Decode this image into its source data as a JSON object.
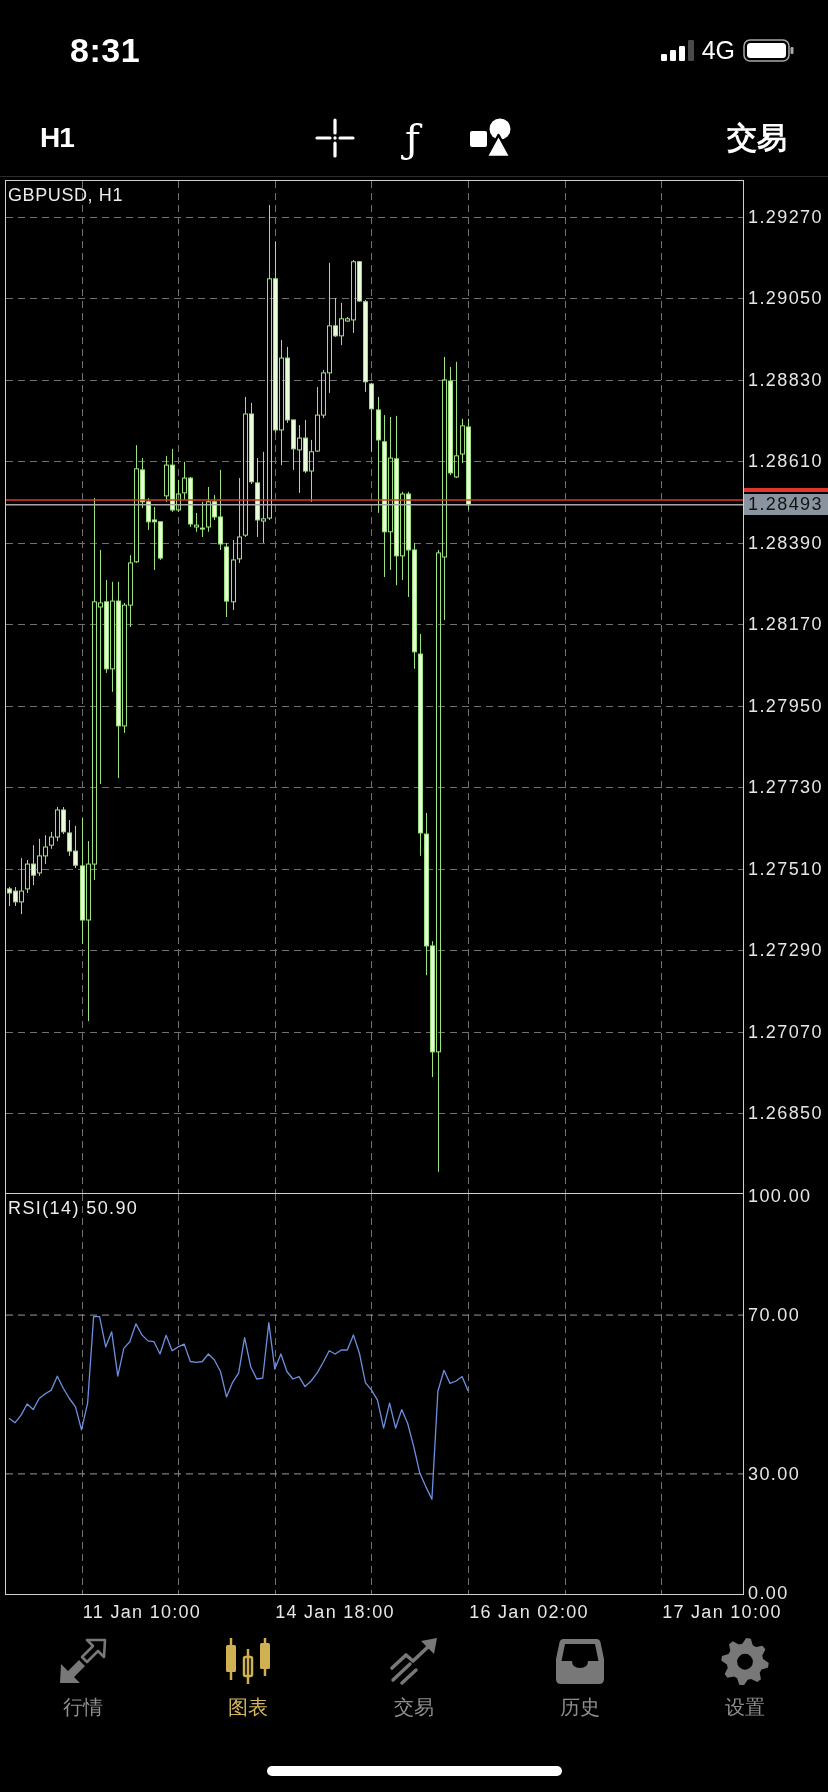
{
  "status_bar": {
    "time": "8:31",
    "network": "4G"
  },
  "toolbar": {
    "timeframe": "H1",
    "function_button": "ƒ",
    "trade_button": "交易"
  },
  "chart": {
    "current_price": "1.28493",
    "chart_data": {
      "type": "candlestick",
      "title": "GBPUSD, H1",
      "grid": true,
      "categories": [
        null,
        null,
        null,
        null,
        null,
        null,
        null,
        null,
        null,
        null,
        null,
        null,
        null,
        null,
        null,
        null,
        null,
        null,
        null,
        null,
        null,
        null,
        null,
        null,
        null,
        null,
        null,
        null,
        null,
        null,
        null,
        null,
        null,
        null,
        null,
        null,
        null,
        null,
        null,
        null,
        null,
        null,
        null,
        null,
        null,
        null,
        null,
        null,
        null,
        null,
        null,
        null,
        null,
        null,
        null,
        null,
        null,
        null,
        null,
        null,
        null,
        null,
        null,
        null,
        null,
        null,
        null,
        null,
        null,
        null,
        null,
        null,
        null,
        null,
        null,
        null,
        null,
        null,
        null,
        null,
        null,
        null,
        null,
        null,
        null,
        null,
        null,
        null,
        null,
        null,
        null,
        null,
        null,
        null,
        null,
        null,
        null,
        null,
        null,
        null,
        null,
        null,
        null,
        null,
        null,
        null,
        null,
        null,
        null,
        null,
        null,
        null,
        null,
        null,
        null,
        null,
        null,
        null,
        null,
        null,
        null,
        null
      ],
      "ohlc": [
        [
          1.27456,
          1.27461,
          1.2741,
          1.27445
        ],
        [
          1.2745,
          1.27461,
          1.2741,
          1.27421
        ],
        [
          1.27421,
          1.27539,
          1.27388,
          1.2745
        ],
        [
          1.27456,
          1.27534,
          1.27445,
          1.27523
        ],
        [
          1.27523,
          1.27574,
          1.27466,
          1.27493
        ],
        [
          1.27499,
          1.27591,
          1.27491,
          1.27545
        ],
        [
          1.27545,
          1.27601,
          1.27523,
          1.27569
        ],
        [
          1.27574,
          1.2761,
          1.27564,
          1.27596
        ],
        [
          1.27596,
          1.27677,
          1.27585,
          1.27669
        ],
        [
          1.27669,
          1.27677,
          1.27604,
          1.2761
        ],
        [
          1.27607,
          1.27642,
          1.27545,
          1.27558
        ],
        [
          1.27558,
          1.27626,
          1.27512,
          1.2752
        ],
        [
          1.27518,
          1.27647,
          1.27307,
          1.27372
        ],
        [
          1.27372,
          1.27585,
          1.27099,
          1.27523
        ],
        [
          1.27523,
          1.28511,
          1.2748,
          1.28231
        ],
        [
          1.28217,
          1.28371,
          1.27739,
          1.28228
        ],
        [
          1.28231,
          1.2829,
          1.28039,
          1.2805
        ],
        [
          1.2805,
          1.28285,
          1.27988,
          1.28233
        ],
        [
          1.28233,
          1.28285,
          1.27755,
          1.27896
        ],
        [
          1.27896,
          1.28228,
          1.27877,
          1.28222
        ],
        [
          1.28222,
          1.28357,
          1.28163,
          1.28336
        ],
        [
          1.28339,
          1.28654,
          1.28336,
          1.2859
        ],
        [
          1.28587,
          1.28619,
          1.28484,
          1.28501
        ],
        [
          1.28501,
          1.28511,
          1.28425,
          1.28447
        ],
        [
          1.28452,
          1.28487,
          1.28317,
          1.28447
        ],
        [
          1.28447,
          1.28447,
          1.28344,
          1.28349
        ],
        [
          1.28517,
          1.28625,
          1.28501,
          1.286
        ],
        [
          1.286,
          1.28644,
          1.28474,
          1.28479
        ],
        [
          1.28479,
          1.2856,
          1.28474,
          1.28522
        ],
        [
          1.28525,
          1.28609,
          1.28506,
          1.28565
        ],
        [
          1.28565,
          1.28568,
          1.28433,
          1.28441
        ],
        [
          1.28433,
          1.28471,
          1.2842,
          1.28438
        ],
        [
          1.28428,
          1.28501,
          1.28406,
          1.2843
        ],
        [
          1.28433,
          1.28541,
          1.2842,
          1.28501
        ],
        [
          1.28501,
          1.28519,
          1.28452,
          1.2846
        ],
        [
          1.2846,
          1.28587,
          1.28371,
          1.28387
        ],
        [
          1.28379,
          1.2839,
          1.2819,
          1.28233
        ],
        [
          1.28231,
          1.28398,
          1.28209,
          1.28344
        ],
        [
          1.28347,
          1.28565,
          1.28336,
          1.28406
        ],
        [
          1.28411,
          1.28784,
          1.28406,
          1.28738
        ],
        [
          1.28738,
          1.28768,
          1.28549,
          1.28555
        ],
        [
          1.28552,
          1.28619,
          1.28406,
          1.28452
        ],
        [
          1.28449,
          1.28636,
          1.2839,
          1.28455
        ],
        [
          1.28457,
          1.29302,
          1.28452,
          1.29103
        ],
        [
          1.29103,
          1.29203,
          1.28687,
          1.28695
        ],
        [
          1.28695,
          1.28938,
          1.286,
          1.28889
        ],
        [
          1.28889,
          1.28919,
          1.28714,
          1.28722
        ],
        [
          1.28722,
          1.28722,
          1.28587,
          1.28644
        ],
        [
          1.28641,
          1.28708,
          1.28525,
          1.28673
        ],
        [
          1.28673,
          1.28722,
          1.28579,
          1.28584
        ],
        [
          1.28584,
          1.28668,
          1.28501,
          1.28636
        ],
        [
          1.28638,
          1.28811,
          1.28636,
          1.28735
        ],
        [
          1.28735,
          1.28857,
          1.28727,
          1.28849
        ],
        [
          1.28849,
          1.29146,
          1.28795,
          1.28976
        ],
        [
          1.28976,
          1.29051,
          1.28946,
          1.28949
        ],
        [
          1.28949,
          1.29038,
          1.28924,
          1.28995
        ],
        [
          1.28989,
          1.29,
          1.28987,
          1.28995
        ],
        [
          1.28992,
          1.29154,
          1.28957,
          1.29149
        ],
        [
          1.29149,
          1.29151,
          1.29041,
          1.29043
        ],
        [
          1.29041,
          1.29046,
          1.28798,
          1.28825
        ],
        [
          1.28819,
          1.28822,
          1.28636,
          1.28752
        ],
        [
          1.28749,
          1.28784,
          1.28471,
          1.28668
        ],
        [
          1.28663,
          1.28735,
          1.28298,
          1.2842
        ],
        [
          1.2842,
          1.2873,
          1.28317,
          1.28619
        ],
        [
          1.28617,
          1.28733,
          1.28276,
          1.28355
        ],
        [
          1.28355,
          1.28528,
          1.2829,
          1.28522
        ],
        [
          1.28522,
          1.28528,
          1.28244,
          1.28371
        ],
        [
          1.28371,
          1.2839,
          1.2805,
          1.28096
        ],
        [
          1.2809,
          1.28144,
          1.27545,
          1.27607
        ],
        [
          1.27604,
          1.27661,
          1.27223,
          1.27302
        ],
        [
          1.27302,
          1.27315,
          1.26948,
          1.27016
        ],
        [
          1.27016,
          1.28371,
          1.26692,
          1.28363
        ],
        [
          1.28352,
          1.28892,
          1.28182,
          1.2883
        ],
        [
          1.28827,
          1.28865,
          1.28573,
          1.28579
        ],
        [
          1.28568,
          1.28879,
          1.28565,
          1.28625
        ],
        [
          1.2863,
          1.28725,
          1.28606,
          1.28706
        ],
        [
          1.28703,
          1.28725,
          1.28479,
          1.28493
        ],
        null,
        null,
        null,
        null,
        null,
        null,
        null,
        null,
        null,
        null,
        null,
        null,
        null,
        null,
        null,
        null,
        null,
        null,
        null,
        null,
        null,
        null,
        null,
        null,
        null,
        null,
        null,
        null,
        null,
        null,
        null,
        null,
        null,
        null,
        null,
        null,
        null,
        null,
        null,
        null,
        null,
        null,
        null,
        null,
        null
      ],
      "ylim": [
        1.26635,
        1.29367
      ],
      "yticks": [
        {
          "value": 1.2927,
          "label": "1.29270"
        },
        {
          "value": 1.2905,
          "label": "1.29050"
        },
        {
          "value": 1.2883,
          "label": "1.28830"
        },
        {
          "value": 1.2861,
          "label": "1.28610"
        },
        {
          "value": 1.2839,
          "label": "1.28390"
        },
        {
          "value": 1.2817,
          "label": "1.28170"
        },
        {
          "value": 1.2795,
          "label": "1.27950"
        },
        {
          "value": 1.2773,
          "label": "1.27730"
        },
        {
          "value": 1.2751,
          "label": "1.27510"
        },
        {
          "value": 1.2729,
          "label": "1.27290"
        },
        {
          "value": 1.2707,
          "label": "1.27070"
        },
        {
          "value": 1.2685,
          "label": "1.26850"
        }
      ],
      "ref_lines": [
        {
          "axis": "y",
          "value": 1.28506,
          "color": "#d8392d"
        },
        {
          "axis": "y",
          "value": 1.28493,
          "color": "#a9a9a9"
        }
      ]
    }
  },
  "indicator": {
    "chart_data": {
      "type": "line",
      "title": "RSI(14) 50.90",
      "grid": true,
      "categories": [
        null,
        null,
        null,
        null,
        null,
        null,
        null,
        null,
        null,
        null,
        null,
        null,
        null,
        null,
        null,
        null,
        null,
        null,
        null,
        null,
        null,
        null,
        "11 Jan 10:00",
        null,
        null,
        null,
        null,
        null,
        null,
        null,
        null,
        null,
        null,
        null,
        null,
        null,
        null,
        null,
        null,
        null,
        null,
        null,
        null,
        null,
        null,
        null,
        null,
        null,
        null,
        null,
        null,
        null,
        null,
        null,
        "14 Jan 18:00",
        null,
        null,
        null,
        null,
        null,
        null,
        null,
        null,
        null,
        null,
        null,
        null,
        null,
        null,
        null,
        null,
        null,
        null,
        null,
        null,
        null,
        null,
        null,
        null,
        null,
        null,
        null,
        null,
        null,
        null,
        null,
        "16 Jan 02:00",
        null,
        null,
        null,
        null,
        null,
        null,
        null,
        null,
        null,
        null,
        null,
        null,
        null,
        null,
        null,
        null,
        null,
        null,
        null,
        null,
        null,
        null,
        null,
        null,
        null,
        null,
        null,
        null,
        null,
        null,
        null,
        "17 Jan 10:00",
        null,
        null,
        null
      ],
      "series": [
        {
          "color": "#6d8fe0",
          "values": [
            44.0,
            42.9,
            44.8,
            47.6,
            46.2,
            49.0,
            50.2,
            51.1,
            54.6,
            51.5,
            49.0,
            46.9,
            41.1,
            47.8,
            69.6,
            69.6,
            62.0,
            65.8,
            54.6,
            61.6,
            63.3,
            67.8,
            65.0,
            63.5,
            63.3,
            60.2,
            64.9,
            61.0,
            62.0,
            62.7,
            58.3,
            58.1,
            58.3,
            60.2,
            58.7,
            55.8,
            49.4,
            53.0,
            55.4,
            64.3,
            57.0,
            53.9,
            54.1,
            68.1,
            56.4,
            60.2,
            55.8,
            53.9,
            54.5,
            52.0,
            53.4,
            55.4,
            58.1,
            61.0,
            60.2,
            61.2,
            61.2,
            65.0,
            60.4,
            53.0,
            51.1,
            48.6,
            41.5,
            47.8,
            41.5,
            46.2,
            42.7,
            36.8,
            30.2,
            26.8,
            23.6,
            50.8,
            56.1,
            52.8,
            53.4,
            54.5,
            50.9,
            null,
            null,
            null,
            null,
            null,
            null,
            null,
            null,
            null,
            null,
            null,
            null,
            null,
            null,
            null,
            null,
            null,
            null,
            null,
            null,
            null,
            null,
            null,
            null,
            null,
            null,
            null,
            null,
            null,
            null,
            null,
            null,
            null,
            null,
            null,
            null,
            null,
            null,
            null,
            null,
            null,
            null,
            null,
            null,
            null
          ]
        }
      ],
      "ylim": [
        -0.5,
        100.75
      ],
      "yticks": [
        {
          "value": 100,
          "label": "100.00"
        },
        {
          "value": 70,
          "label": "70.00"
        },
        {
          "value": 30,
          "label": "30.00"
        },
        {
          "value": 0,
          "label": "0.00"
        }
      ],
      "ref_lines": [
        {
          "axis": "y",
          "value": 70,
          "color": "#9a9a9a"
        },
        {
          "axis": "y",
          "value": 30,
          "color": "#9a9a9a"
        }
      ]
    }
  },
  "tab_bar": {
    "tabs": [
      {
        "label": "行情",
        "selected": false
      },
      {
        "label": "图表",
        "selected": true
      },
      {
        "label": "交易",
        "selected": false
      },
      {
        "label": "历史",
        "selected": false
      },
      {
        "label": "设置",
        "selected": false
      }
    ]
  }
}
